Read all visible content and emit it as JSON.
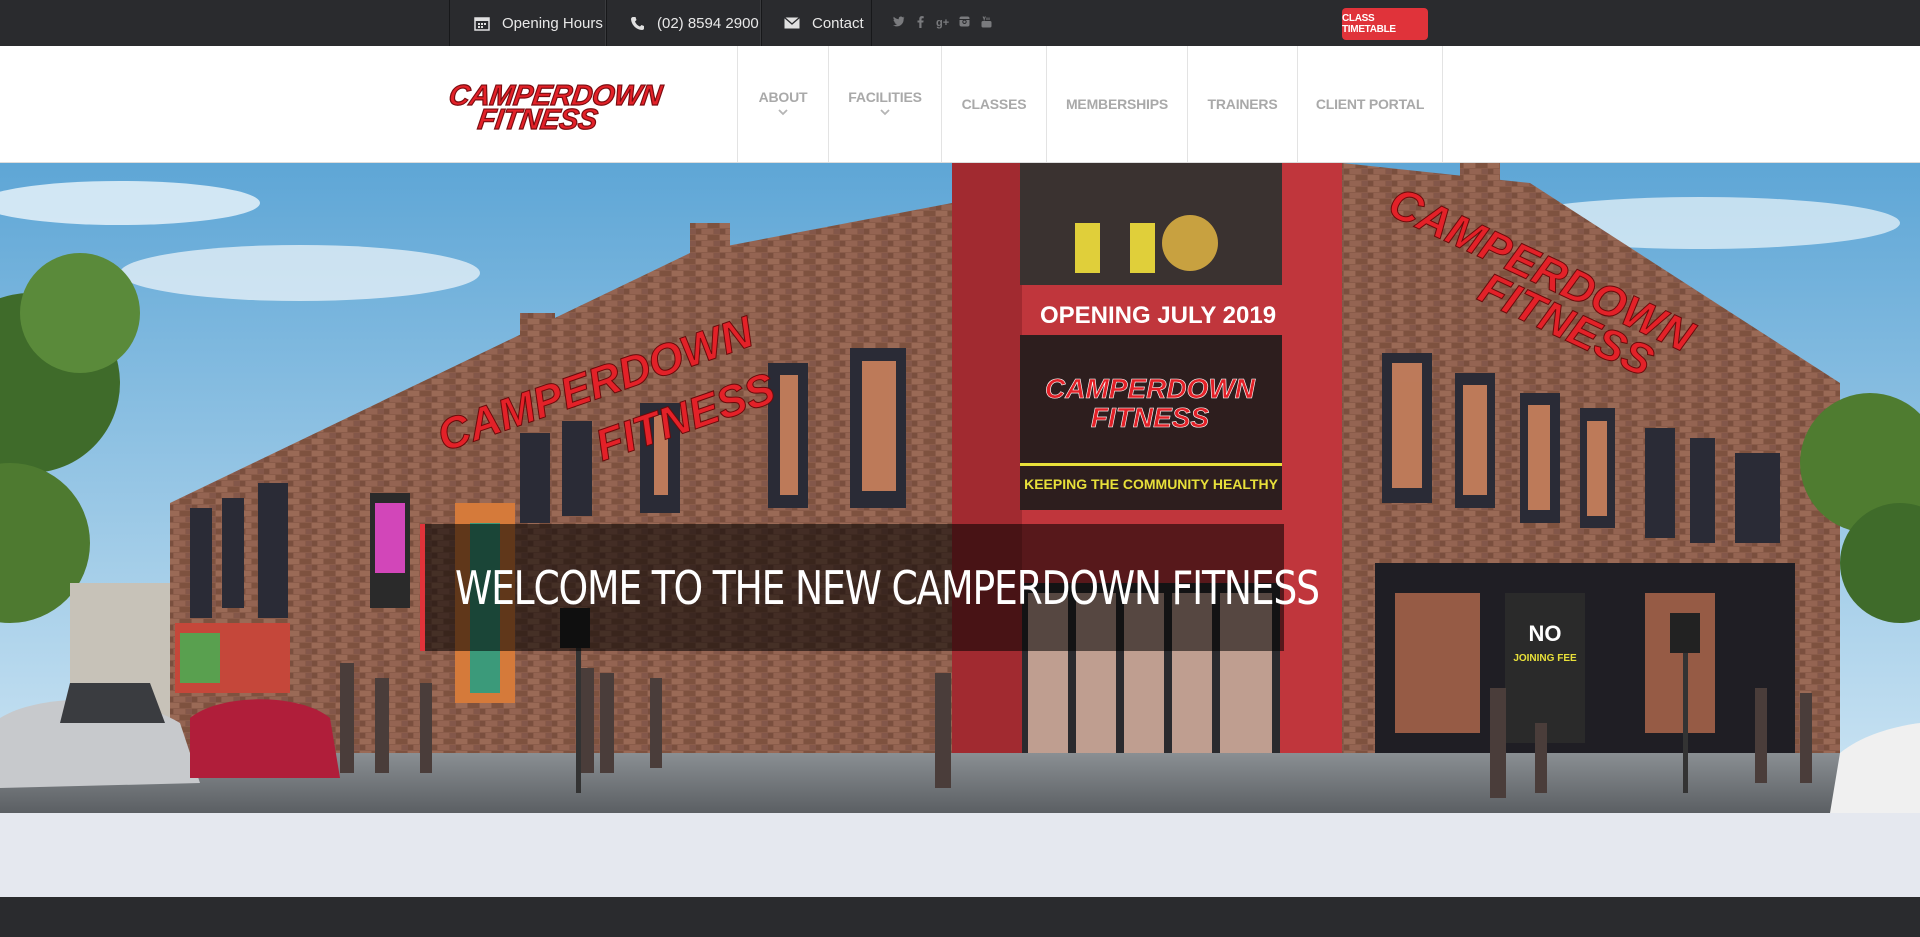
{
  "topbar": {
    "opening_hours": "Opening Hours",
    "phone": "(02) 8594 2900",
    "contact": "Contact",
    "social_icons": [
      "twitter-icon",
      "facebook-icon",
      "google-plus-icon",
      "instagram-icon",
      "youtube-icon"
    ],
    "class_timetable": "CLASS TIMETABLE"
  },
  "header": {
    "logo_line1": "CAMPERDOWN",
    "logo_line2": "FITNESS",
    "nav": [
      {
        "label": "ABOUT",
        "has_dropdown": true
      },
      {
        "label": "FACILITIES",
        "has_dropdown": true
      },
      {
        "label": "CLASSES",
        "has_dropdown": false
      },
      {
        "label": "MEMBERSHIPS",
        "has_dropdown": false
      },
      {
        "label": "TRAINERS",
        "has_dropdown": false
      },
      {
        "label": "CLIENT PORTAL",
        "has_dropdown": false
      }
    ]
  },
  "hero": {
    "welcome": "WELCOME TO THE NEW CAMPERDOWN FITNESS",
    "building_sign_left_1": "CAMPERDOWN",
    "building_sign_left_2": "FITNESS",
    "building_sign_right_1": "CAMPERDOWN",
    "building_sign_right_2": "FITNESS",
    "opening_banner": "OPENING JULY 2019",
    "poster_line1": "CAMPERDOWN",
    "poster_line2": "FITNESS",
    "poster_tagline": "KEEPING THE COMMUNITY HEALTHY",
    "no_joining_fee_1": "NO",
    "no_joining_fee_2": "JOINING FEE"
  },
  "colors": {
    "accent": "#e0333a",
    "topbar_bg": "#2a2b2e",
    "brick": "#8a5a48"
  }
}
